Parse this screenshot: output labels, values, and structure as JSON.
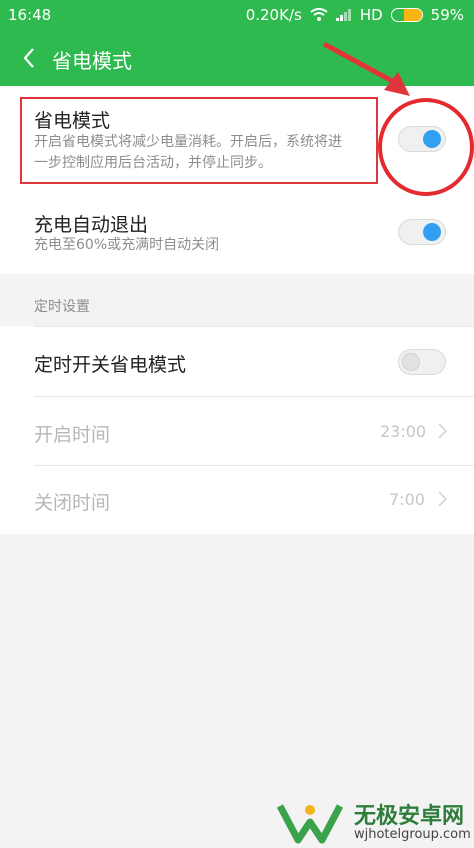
{
  "status_bar": {
    "time": "16:48",
    "net_speed": "0.20K/s",
    "network": "HD",
    "battery_percent": "59%",
    "battery_level": 0.59,
    "icons": [
      "wifi-icon",
      "signal-icon",
      "battery-icon"
    ]
  },
  "header": {
    "back_icon": "chevron-left-icon",
    "title": "省电模式"
  },
  "settings": {
    "power_saving": {
      "title": "省电模式",
      "description_line1": "开启省电模式将减少电量消耗。开启后，系统将进",
      "description_line2": "一步控制应用后台活动，并停止同步。",
      "enabled": true
    },
    "auto_exit": {
      "title": "充电自动退出",
      "description": "充电至60%或充满时自动关闭",
      "enabled": true
    }
  },
  "schedule": {
    "section_label": "定时设置",
    "toggle_row": {
      "title": "定时开关省电模式",
      "enabled": false
    },
    "start_time": {
      "label": "开启时间",
      "value": "23:00"
    },
    "end_time": {
      "label": "关闭时间",
      "value": "7:00"
    }
  },
  "watermark": {
    "title": "无极安卓网",
    "url": "wjhotelgroup.com"
  },
  "colors": {
    "header_green": "#2fba4f",
    "toggle_blue": "#32a0f0",
    "annotation_red": "#e0363b"
  }
}
